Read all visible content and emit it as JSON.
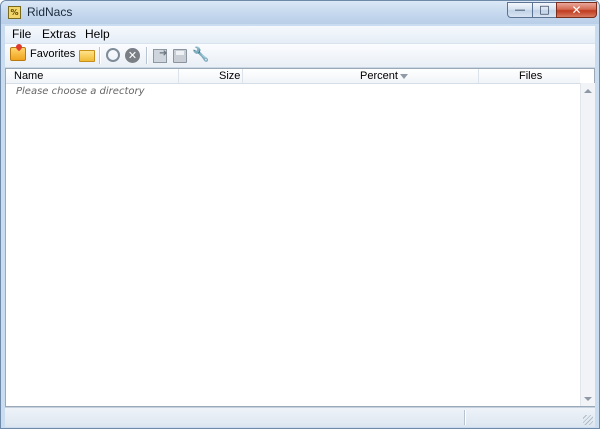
{
  "window": {
    "title": "RidNacs",
    "app_icon_text": "%",
    "controls": {
      "minimize": "—",
      "maximize": "□",
      "close": "✕"
    }
  },
  "menu": {
    "items": [
      "File",
      "Extras",
      "Help"
    ]
  },
  "toolbar": {
    "favorites_label": "Favorites",
    "icons": [
      "favorites-icon",
      "folder-icon",
      "refresh-icon",
      "stop-icon",
      "export-icon",
      "save-icon",
      "settings-icon"
    ]
  },
  "table": {
    "columns": [
      "Name",
      "Size",
      "Percent",
      "Files"
    ],
    "sorted_column": "Percent",
    "placeholder": "Please choose a directory"
  },
  "colors": {
    "frame": "#c9dcf0",
    "close_button": "#c03b1e",
    "content_background": "#ffffff"
  }
}
